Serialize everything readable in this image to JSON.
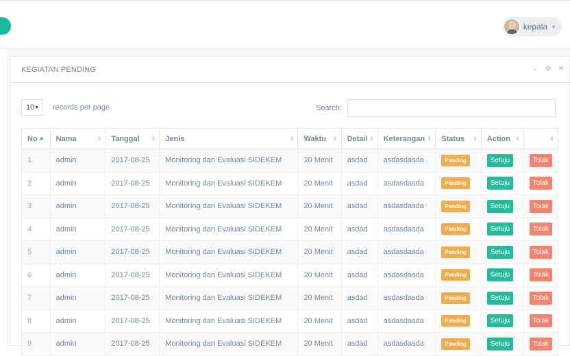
{
  "user": {
    "name": "kepala",
    "avatar_icon": "user-avatar-icon"
  },
  "panel": {
    "title": "KEGIATAN PENDING",
    "tools": {
      "collapse": "⌄",
      "settings": "⚙",
      "close": "✕"
    }
  },
  "records": {
    "value": "10",
    "label": "records per page"
  },
  "search": {
    "label": "Search:",
    "value": "",
    "placeholder": ""
  },
  "table": {
    "headers": [
      "No",
      "Nama",
      "Tanggal",
      "Jenis",
      "Waktu",
      "Detail",
      "Keterangan",
      "Status",
      "Action",
      ""
    ],
    "rows": [
      {
        "no": "1",
        "nama": "admin",
        "tanggal": "2017-08-25",
        "jenis": "Monitoring dan Evaluasi SIDEKEM",
        "waktu": "20 Menit",
        "detail": "asdad",
        "keterangan": "asdasdasda",
        "status": "Pending",
        "setuju": "Setuju",
        "tolak": "Tolak"
      },
      {
        "no": "2",
        "nama": "admin",
        "tanggal": "2017-08-25",
        "jenis": "Monitoring dan Evaluasi SIDEKEM",
        "waktu": "20 Menit",
        "detail": "asdad",
        "keterangan": "asdasdasda",
        "status": "Pending",
        "setuju": "Setuju",
        "tolak": "Tolak"
      },
      {
        "no": "3",
        "nama": "admin",
        "tanggal": "2017-08-25",
        "jenis": "Monitoring dan Evaluasi SIDEKEM",
        "waktu": "20 Menit",
        "detail": "asdad",
        "keterangan": "asdasdasda",
        "status": "Pending",
        "setuju": "Setuju",
        "tolak": "Tolak"
      },
      {
        "no": "4",
        "nama": "admin",
        "tanggal": "2017-08-25",
        "jenis": "Monitoring dan Evaluasi SIDEKEM",
        "waktu": "20 Menit",
        "detail": "asdad",
        "keterangan": "asdasdasda",
        "status": "Pending",
        "setuju": "Setuju",
        "tolak": "Tolak"
      },
      {
        "no": "5",
        "nama": "admin",
        "tanggal": "2017-08-25",
        "jenis": "Monitoring dan Evaluasi SIDEKEM",
        "waktu": "20 Menit",
        "detail": "asdad",
        "keterangan": "asdasdasda",
        "status": "Pending",
        "setuju": "Setuju",
        "tolak": "Tolak"
      },
      {
        "no": "6",
        "nama": "admin",
        "tanggal": "2017-08-25",
        "jenis": "Monitoring dan Evaluasi SIDEKEM",
        "waktu": "20 Menit",
        "detail": "asdad",
        "keterangan": "asdasdasda",
        "status": "Pending",
        "setuju": "Setuju",
        "tolak": "Tolak"
      },
      {
        "no": "7",
        "nama": "admin",
        "tanggal": "2017-08-25",
        "jenis": "Monitoring dan Evaluasi SIDEKEM",
        "waktu": "20 Menit",
        "detail": "asdad",
        "keterangan": "asdasdasda",
        "status": "Pending",
        "setuju": "Setuju",
        "tolak": "Tolak"
      },
      {
        "no": "8",
        "nama": "admin",
        "tanggal": "2017-08-25",
        "jenis": "Monitoring dan Evaluasi SIDEKEM",
        "waktu": "20 Menit",
        "detail": "asdad",
        "keterangan": "asdasdasda",
        "status": "Pending",
        "setuju": "Setuju",
        "tolak": "Tolak"
      },
      {
        "no": "9",
        "nama": "admin",
        "tanggal": "2017-08-25",
        "jenis": "Monitoring dan Evaluasi SIDEKEM",
        "waktu": "20 Menit",
        "detail": "asdad",
        "keterangan": "asdasdasda",
        "status": "Pending",
        "setuju": "Setuju",
        "tolak": "Tolak"
      }
    ]
  },
  "colors": {
    "accent": "#1abb9c",
    "pending": "#f0ad4e",
    "setuju": "#26b99a",
    "tolak": "#f3826e"
  }
}
